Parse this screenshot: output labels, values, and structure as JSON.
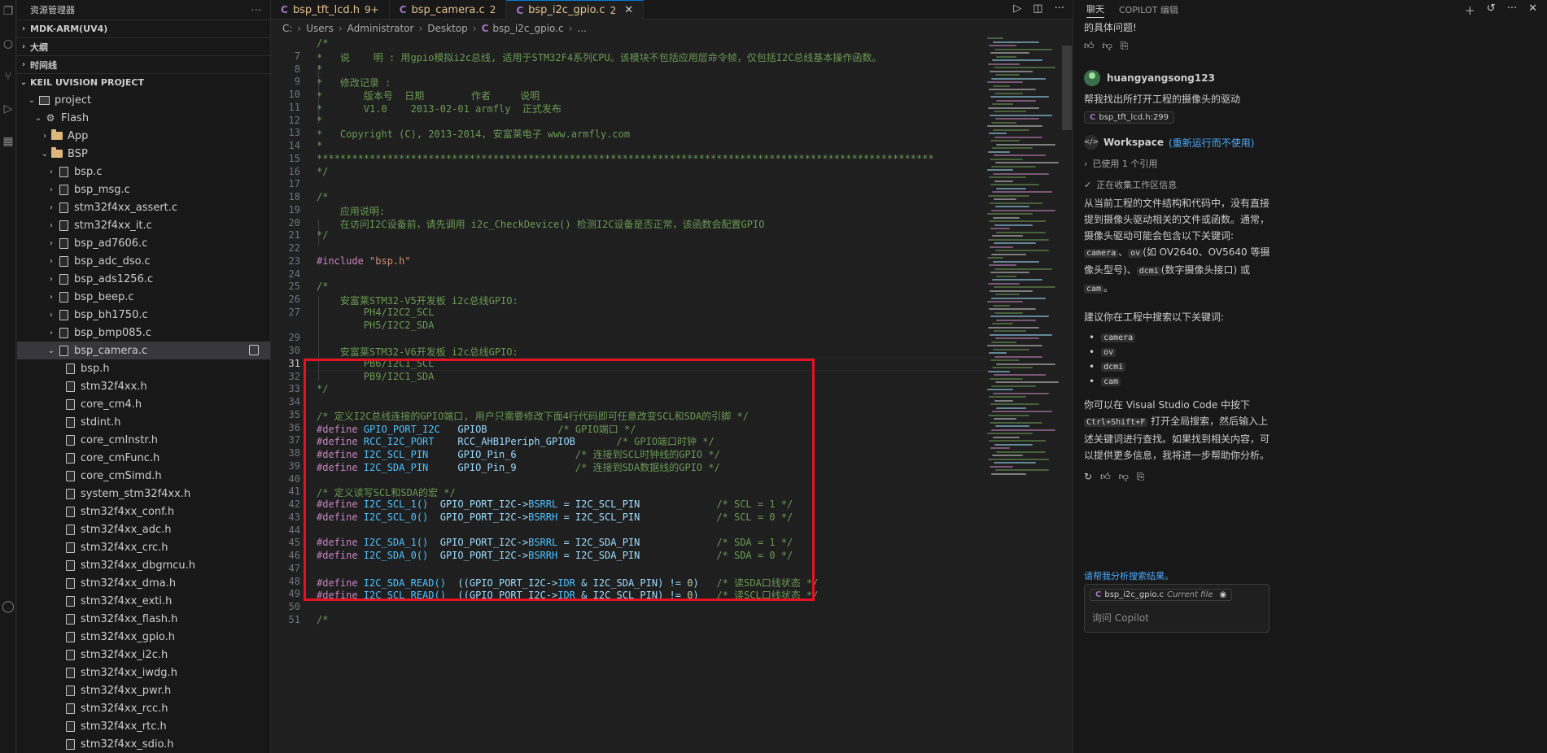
{
  "explorer": {
    "title": "资源管理器",
    "more": "···",
    "sections": [
      "MDK-ARM(UV4)",
      "大纲",
      "时间线"
    ],
    "project_section": "KEIL UVISION PROJECT",
    "tree": [
      {
        "label": "project",
        "kind": "proj",
        "indent": 1,
        "chev": "⌄"
      },
      {
        "label": "Flash",
        "kind": "gear",
        "indent": 2,
        "chev": "⌄"
      },
      {
        "label": "App",
        "kind": "folder",
        "indent": 3,
        "chev": "›"
      },
      {
        "label": "BSP",
        "kind": "folder",
        "indent": 3,
        "chev": "⌄"
      },
      {
        "label": "bsp.c",
        "kind": "file",
        "indent": 4,
        "chev": "›"
      },
      {
        "label": "bsp_msg.c",
        "kind": "file",
        "indent": 4,
        "chev": "›"
      },
      {
        "label": "stm32f4xx_assert.c",
        "kind": "file",
        "indent": 4,
        "chev": "›"
      },
      {
        "label": "stm32f4xx_it.c",
        "kind": "file",
        "indent": 4,
        "chev": "›"
      },
      {
        "label": "bsp_ad7606.c",
        "kind": "file",
        "indent": 4,
        "chev": "›"
      },
      {
        "label": "bsp_adc_dso.c",
        "kind": "file",
        "indent": 4,
        "chev": "›"
      },
      {
        "label": "bsp_ads1256.c",
        "kind": "file",
        "indent": 4,
        "chev": "›"
      },
      {
        "label": "bsp_beep.c",
        "kind": "file",
        "indent": 4,
        "chev": "›"
      },
      {
        "label": "bsp_bh1750.c",
        "kind": "file",
        "indent": 4,
        "chev": "›"
      },
      {
        "label": "bsp_bmp085.c",
        "kind": "file",
        "indent": 4,
        "chev": "›"
      },
      {
        "label": "bsp_camera.c",
        "kind": "file",
        "indent": 4,
        "chev": "⌄",
        "selected": true
      },
      {
        "label": "bsp.h",
        "kind": "file",
        "indent": 5,
        "chev": ""
      },
      {
        "label": "stm32f4xx.h",
        "kind": "file",
        "indent": 5,
        "chev": ""
      },
      {
        "label": "core_cm4.h",
        "kind": "file",
        "indent": 5,
        "chev": ""
      },
      {
        "label": "stdint.h",
        "kind": "file",
        "indent": 5,
        "chev": ""
      },
      {
        "label": "core_cmInstr.h",
        "kind": "file",
        "indent": 5,
        "chev": ""
      },
      {
        "label": "core_cmFunc.h",
        "kind": "file",
        "indent": 5,
        "chev": ""
      },
      {
        "label": "core_cmSimd.h",
        "kind": "file",
        "indent": 5,
        "chev": ""
      },
      {
        "label": "system_stm32f4xx.h",
        "kind": "file",
        "indent": 5,
        "chev": ""
      },
      {
        "label": "stm32f4xx_conf.h",
        "kind": "file",
        "indent": 5,
        "chev": ""
      },
      {
        "label": "stm32f4xx_adc.h",
        "kind": "file",
        "indent": 5,
        "chev": ""
      },
      {
        "label": "stm32f4xx_crc.h",
        "kind": "file",
        "indent": 5,
        "chev": ""
      },
      {
        "label": "stm32f4xx_dbgmcu.h",
        "kind": "file",
        "indent": 5,
        "chev": ""
      },
      {
        "label": "stm32f4xx_dma.h",
        "kind": "file",
        "indent": 5,
        "chev": ""
      },
      {
        "label": "stm32f4xx_exti.h",
        "kind": "file",
        "indent": 5,
        "chev": ""
      },
      {
        "label": "stm32f4xx_flash.h",
        "kind": "file",
        "indent": 5,
        "chev": ""
      },
      {
        "label": "stm32f4xx_gpio.h",
        "kind": "file",
        "indent": 5,
        "chev": ""
      },
      {
        "label": "stm32f4xx_i2c.h",
        "kind": "file",
        "indent": 5,
        "chev": ""
      },
      {
        "label": "stm32f4xx_iwdg.h",
        "kind": "file",
        "indent": 5,
        "chev": ""
      },
      {
        "label": "stm32f4xx_pwr.h",
        "kind": "file",
        "indent": 5,
        "chev": ""
      },
      {
        "label": "stm32f4xx_rcc.h",
        "kind": "file",
        "indent": 5,
        "chev": ""
      },
      {
        "label": "stm32f4xx_rtc.h",
        "kind": "file",
        "indent": 5,
        "chev": ""
      },
      {
        "label": "stm32f4xx_sdio.h",
        "kind": "file",
        "indent": 5,
        "chev": ""
      }
    ]
  },
  "tabs": [
    {
      "label": "bsp_tft_lcd.h",
      "count": "9+",
      "active": false
    },
    {
      "label": "bsp_camera.c",
      "count": "2",
      "active": false
    },
    {
      "label": "bsp_i2c_gpio.c",
      "count": "2",
      "active": true
    }
  ],
  "breadcrumb": [
    "C:",
    "Users",
    "Administrator",
    "Desktop",
    "bsp_i2c_gpio.c",
    "..."
  ],
  "code": {
    "current_line": 31,
    "lines": [
      {
        "n": "",
        "s": [
          [
            "cmt",
            "/*"
          ]
        ]
      },
      {
        "n": "7",
        "s": [
          [
            "cmt",
            "*   说    明 : 用gpio模拟i2c总线, 适用于STM32F4系列CPU。该模块不包括应用层命令帧，仅包括I2C总线基本操作函数。"
          ]
        ]
      },
      {
        "n": "8",
        "s": [
          [
            "cmt",
            "*"
          ]
        ]
      },
      {
        "n": "9",
        "s": [
          [
            "cmt",
            "*   修改记录 :"
          ]
        ]
      },
      {
        "n": "10",
        "s": [
          [
            "cmt",
            "*       版本号  日期        作者     说明"
          ]
        ]
      },
      {
        "n": "11",
        "s": [
          [
            "cmt",
            "*       V1.0    2013-02-01 armfly  正式发布"
          ]
        ]
      },
      {
        "n": "12",
        "s": [
          [
            "cmt",
            "*"
          ]
        ]
      },
      {
        "n": "13",
        "s": [
          [
            "cmt",
            "*   Copyright (C), 2013-2014, 安富莱电子 www.armfly.com"
          ]
        ]
      },
      {
        "n": "14",
        "s": [
          [
            "cmt",
            "*"
          ]
        ]
      },
      {
        "n": "15",
        "s": [
          [
            "cmt",
            "*********************************************************************************************************"
          ]
        ]
      },
      {
        "n": "16",
        "s": [
          [
            "cmt",
            "*/"
          ]
        ]
      },
      {
        "n": "17",
        "s": []
      },
      {
        "n": "18",
        "s": [
          [
            "cmt",
            "/*"
          ]
        ]
      },
      {
        "n": "19",
        "s": [
          [
            "cmt",
            "    应用说明:"
          ]
        ]
      },
      {
        "n": "20",
        "s": [
          [
            "cmt",
            "    在访问I2C设备前，请先调用 i2c_CheckDevice() 检测I2C设备是否正常，该函数会配置GPIO"
          ]
        ]
      },
      {
        "n": "21",
        "s": [
          [
            "cmt",
            "*/"
          ]
        ]
      },
      {
        "n": "22",
        "s": []
      },
      {
        "n": "23",
        "s": [
          [
            "kw",
            "#include "
          ],
          [
            "str",
            "\"bsp.h\""
          ]
        ]
      },
      {
        "n": "24",
        "s": []
      },
      {
        "n": "25",
        "s": [
          [
            "cmt",
            "/*"
          ]
        ]
      },
      {
        "n": "26",
        "s": [
          [
            "cmt",
            "    安富莱STM32-V5开发板 i2c总线GPIO:"
          ]
        ]
      },
      {
        "n": "27",
        "s": [
          [
            "cmt",
            "        PH4/I2C2_SCL"
          ]
        ]
      },
      {
        "n": "",
        "s": [
          [
            "cmt",
            "        PH5/I2C2_SDA"
          ]
        ]
      },
      {
        "n": "29",
        "s": []
      },
      {
        "n": "30",
        "s": [
          [
            "cmt",
            "    安富莱STM32-V6开发板 i2c总线GPIO:"
          ]
        ]
      },
      {
        "n": "31",
        "s": [
          [
            "cmt",
            "        PB6/I2C1_SCL"
          ]
        ]
      },
      {
        "n": "32",
        "s": [
          [
            "cmt",
            "        PB9/I2C1_SDA"
          ]
        ]
      },
      {
        "n": "33",
        "s": [
          [
            "cmt",
            "*/"
          ]
        ]
      },
      {
        "n": "34",
        "s": []
      },
      {
        "n": "35",
        "s": [
          [
            "cmt",
            "/* 定义I2C总线连接的GPIO端口, 用户只需要修改下面4行代码即可任意改变SCL和SDA的引脚 */"
          ]
        ]
      },
      {
        "n": "36",
        "s": [
          [
            "kw",
            "#define "
          ],
          [
            "mac",
            "GPIO_PORT_I2C"
          ],
          [
            "id",
            "   GPIOB            "
          ],
          [
            "cmt",
            "/* GPIO端口 */"
          ]
        ]
      },
      {
        "n": "37",
        "s": [
          [
            "kw",
            "#define "
          ],
          [
            "mac",
            "RCC_I2C_PORT"
          ],
          [
            "id",
            "    RCC_AHB1Periph_GPIOB       "
          ],
          [
            "cmt",
            "/* GPIO端口时钟 */"
          ]
        ]
      },
      {
        "n": "38",
        "s": [
          [
            "kw",
            "#define "
          ],
          [
            "mac",
            "I2C_SCL_PIN"
          ],
          [
            "id",
            "     GPIO_Pin_6          "
          ],
          [
            "cmt",
            "/* 连接到SCL时钟线的GPIO */"
          ]
        ]
      },
      {
        "n": "39",
        "s": [
          [
            "kw",
            "#define "
          ],
          [
            "mac",
            "I2C_SDA_PIN"
          ],
          [
            "id",
            "     GPIO_Pin_9          "
          ],
          [
            "cmt",
            "/* 连接到SDA数据线的GPIO */"
          ]
        ]
      },
      {
        "n": "40",
        "s": []
      },
      {
        "n": "41",
        "s": [
          [
            "cmt",
            "/* 定义读写SCL和SDA的宏 */"
          ]
        ]
      },
      {
        "n": "42",
        "s": [
          [
            "kw",
            "#define "
          ],
          [
            "mac",
            "I2C_SCL_1()"
          ],
          [
            "id",
            "  GPIO_PORT_I2C->"
          ],
          [
            "mac",
            "BSRRL"
          ],
          [
            "id",
            " = I2C_SCL_PIN             "
          ],
          [
            "cmt",
            "/* SCL = 1 */"
          ]
        ]
      },
      {
        "n": "43",
        "s": [
          [
            "kw",
            "#define "
          ],
          [
            "mac",
            "I2C_SCL_0()"
          ],
          [
            "id",
            "  GPIO_PORT_I2C->"
          ],
          [
            "mac",
            "BSRRH"
          ],
          [
            "id",
            " = I2C_SCL_PIN             "
          ],
          [
            "cmt",
            "/* SCL = 0 */"
          ]
        ]
      },
      {
        "n": "44",
        "s": []
      },
      {
        "n": "45",
        "s": [
          [
            "kw",
            "#define "
          ],
          [
            "mac",
            "I2C_SDA_1()"
          ],
          [
            "id",
            "  GPIO_PORT_I2C->"
          ],
          [
            "mac",
            "BSRRL"
          ],
          [
            "id",
            " = I2C_SDA_PIN             "
          ],
          [
            "cmt",
            "/* SDA = 1 */"
          ]
        ]
      },
      {
        "n": "46",
        "s": [
          [
            "kw",
            "#define "
          ],
          [
            "mac",
            "I2C_SDA_0()"
          ],
          [
            "id",
            "  GPIO_PORT_I2C->"
          ],
          [
            "mac",
            "BSRRH"
          ],
          [
            "id",
            " = I2C_SDA_PIN             "
          ],
          [
            "cmt",
            "/* SDA = 0 */"
          ]
        ]
      },
      {
        "n": "47",
        "s": []
      },
      {
        "n": "48",
        "s": [
          [
            "kw",
            "#define "
          ],
          [
            "mac",
            "I2C_SDA_READ()"
          ],
          [
            "id",
            "  ((GPIO_PORT_I2C->"
          ],
          [
            "mac",
            "IDR"
          ],
          [
            "id",
            " & I2C_SDA_PIN) != "
          ],
          [
            "num",
            "0"
          ],
          [
            "id",
            ")   "
          ],
          [
            "cmt",
            "/* 读SDA口线状态 */"
          ]
        ]
      },
      {
        "n": "49",
        "s": [
          [
            "kw",
            "#define "
          ],
          [
            "mac",
            "I2C_SCL_READ()"
          ],
          [
            "id",
            "  ((GPIO_PORT_I2C->"
          ],
          [
            "mac",
            "IDR"
          ],
          [
            "id",
            " & I2C_SCL_PIN) != "
          ],
          [
            "num",
            "0"
          ],
          [
            "id",
            ")   "
          ],
          [
            "cmt",
            "/* 读SCL口线状态 */"
          ]
        ]
      },
      {
        "n": "50",
        "s": []
      },
      {
        "n": "51",
        "s": [
          [
            "cmt",
            "/*"
          ]
        ]
      }
    ]
  },
  "chat": {
    "tab_chat": "聊天",
    "tab_editor": "COPILOT 编辑",
    "prev_tail": "的具体问题!",
    "user_name": "huangyangsong123",
    "user_msg": "帮我找出所打开工程的摄像头的驱动",
    "user_ref": "bsp_tft_lcd.h:299",
    "workspace": "Workspace",
    "workspace_link": "(重新运行而不使用)",
    "status1": "已使用 1 个引用",
    "status2": "正在收集工作区信息",
    "answer_p1a": "从当前工程的文件结构和代码中，没有直接提到摄像头驱动相关的文件或函数。通常，摄像头驱动可能会包含以下关键词: ",
    "kw_camera": "camera",
    "kw_ov": "ov",
    "answer_p1b": "(如 OV2640、OV5640 等摄像头型号)、",
    "kw_dcmi": "dcmi",
    "answer_p1c": "(数字摄像头接口) 或 ",
    "kw_cam": "cam",
    "answer_p1d": "。",
    "answer_p2": "建议你在工程中搜索以下关键词:",
    "keywords": [
      "camera",
      "ov",
      "dcmi",
      "cam"
    ],
    "answer_p3a": "你可以在 Visual Studio Code 中按下 ",
    "shortcut": "Ctrl+Shift+F",
    "answer_p3b": " 打开全局搜索，然后输入上述关键词进行查找。如果找到相关内容，可以提供更多信息，我将进一步帮助你分析。",
    "suggest": "请帮我分析搜索结果。",
    "current_file": "bsp_i2c_gpio.c",
    "current_file_tag": "Current file",
    "input_placeholder": "询问 Copilot"
  },
  "colors": {
    "highlight_box": "#e81123",
    "accent": "#0078d4",
    "link": "#4daafc"
  }
}
